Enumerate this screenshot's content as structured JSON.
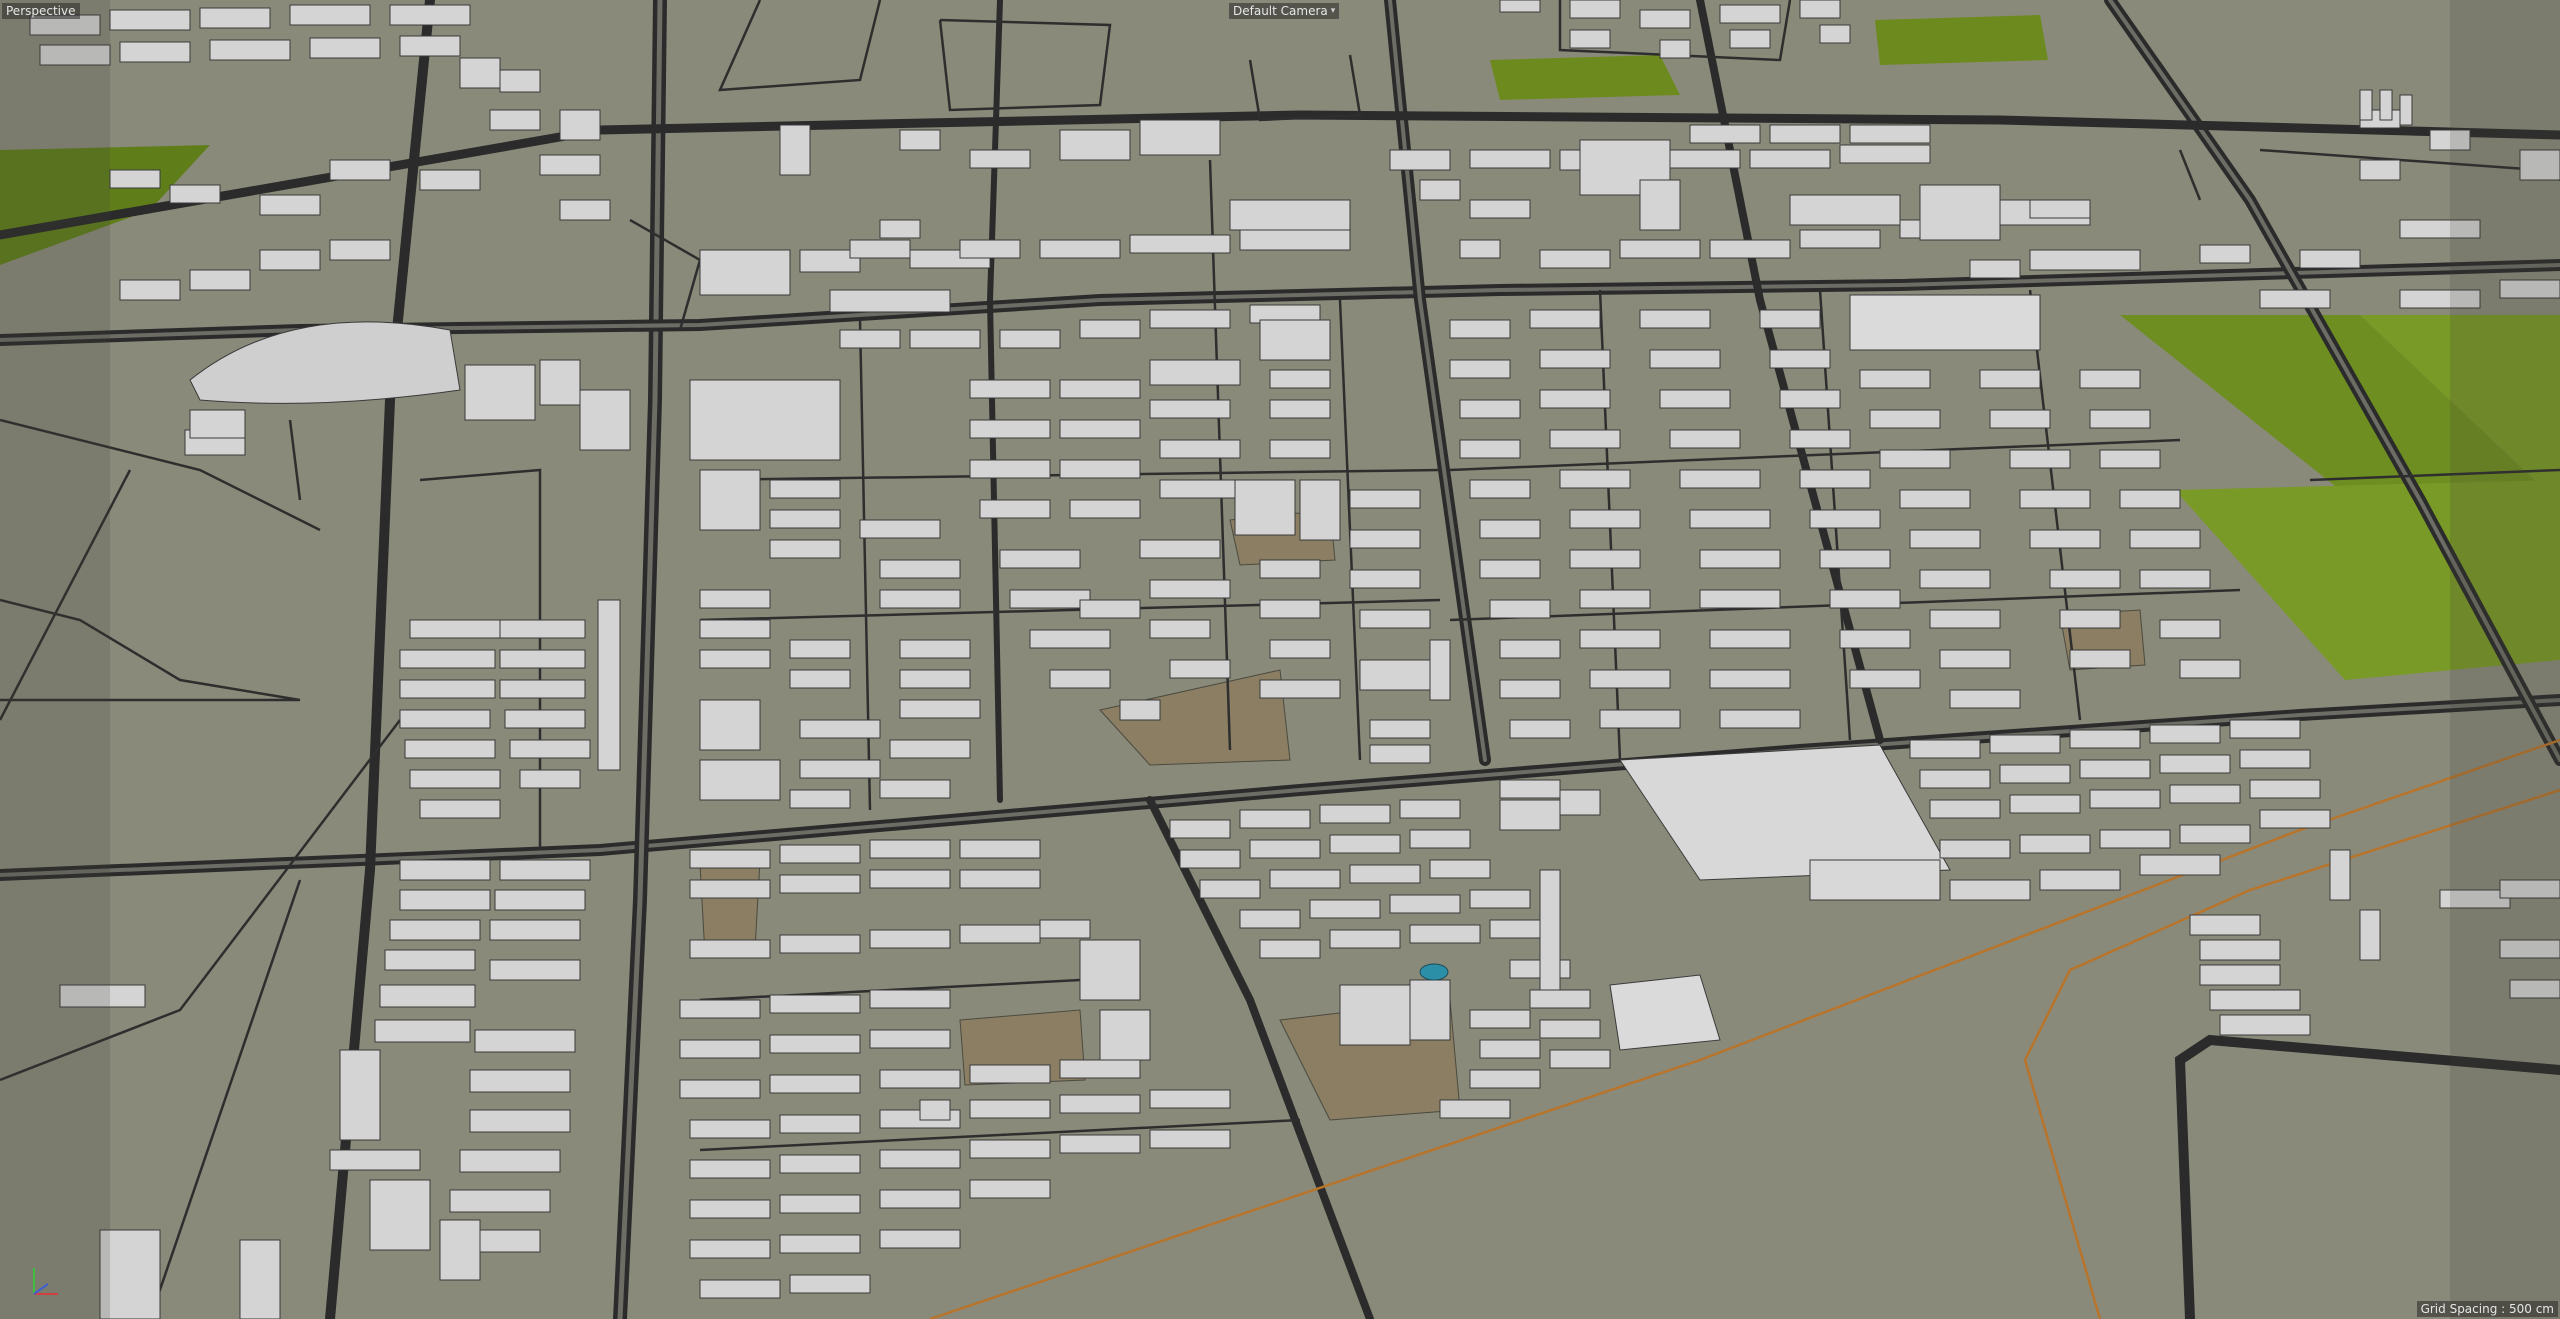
{
  "viewport": {
    "view_label": "Perspective",
    "camera_label": "Default Camera",
    "grid_spacing_label": "Grid Spacing : 500 cm"
  },
  "colors": {
    "ground": "#8a8a7a",
    "road_dark": "#2b2b2b",
    "road_fill": "#6d6d66",
    "building_top": "#d4d4d4",
    "building_side": "#a8a8a8",
    "plaza": "#8b7e63",
    "grass": "#6d8a1e",
    "rail": "#b8742a",
    "water": "#2c8fa8"
  },
  "icons": {
    "axis_gizmo": "xyz-axis-icon",
    "dropdown": "chevron-down-icon"
  }
}
